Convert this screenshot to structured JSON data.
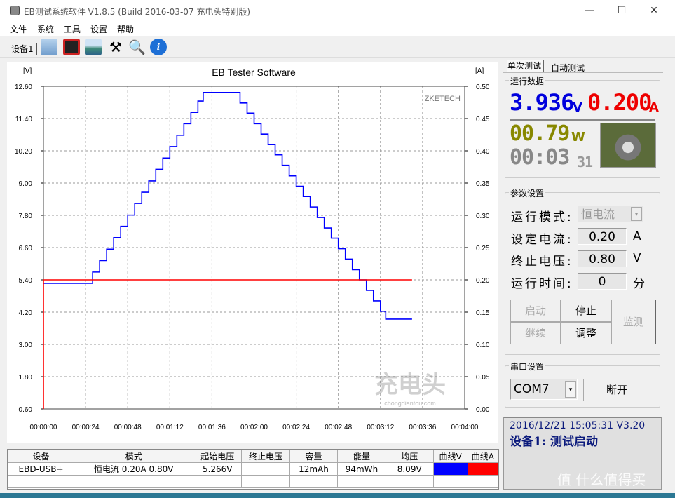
{
  "window": {
    "title": "EB测试系统软件 V1.8.5 (Build 2016-03-07 充电头特别版)",
    "minimize": "—",
    "maximize": "☐",
    "close": "✕"
  },
  "menu": [
    "文件",
    "系统",
    "工具",
    "设置",
    "帮助"
  ],
  "toolbar": {
    "device_tab": "设备1",
    "icons": [
      "folder-open-icon",
      "save-icon",
      "image-icon",
      "tools-icon",
      "search-icon",
      "info-icon"
    ]
  },
  "chart_data": {
    "type": "line",
    "title": "EB Tester Software",
    "ylabel": "[V]",
    "y2label": "[A]",
    "watermark": "ZKETECH",
    "logo_text": "充电头 chongdiantou.com",
    "xlim": [
      "00:00:00",
      "00:04:00"
    ],
    "ylim": [
      0.6,
      12.6
    ],
    "y2lim": [
      0,
      0.5
    ],
    "grid": true,
    "xticks": [
      "00:00:00",
      "00:00:24",
      "00:00:48",
      "00:01:12",
      "00:01:36",
      "00:02:00",
      "00:02:24",
      "00:02:48",
      "00:03:12",
      "00:03:36",
      "00:04:00"
    ],
    "yticks": [
      "0.60",
      "1.80",
      "3.00",
      "4.20",
      "5.40",
      "6.60",
      "7.80",
      "9.00",
      "10.20",
      "11.40",
      "12.60"
    ],
    "y2ticks": [
      "0.00",
      "0.05",
      "0.10",
      "0.15",
      "0.20",
      "0.25",
      "0.30",
      "0.35",
      "0.40",
      "0.45",
      "0.50"
    ],
    "series": [
      {
        "axis": "left",
        "color": "#0000ff",
        "points": [
          [
            0,
            5.27
          ],
          [
            24,
            5.27
          ],
          [
            28,
            5.69
          ],
          [
            32,
            6.12
          ],
          [
            36,
            6.54
          ],
          [
            40,
            6.97
          ],
          [
            44,
            7.39
          ],
          [
            48,
            7.81
          ],
          [
            52,
            8.24
          ],
          [
            56,
            8.66
          ],
          [
            60,
            9.08
          ],
          [
            64,
            9.51
          ],
          [
            68,
            9.93
          ],
          [
            72,
            10.36
          ],
          [
            76,
            10.78
          ],
          [
            80,
            11.21
          ],
          [
            84,
            11.63
          ],
          [
            88,
            12.05
          ],
          [
            91,
            12.37
          ],
          [
            108,
            12.37
          ],
          [
            112,
            11.98
          ],
          [
            116,
            11.6
          ],
          [
            120,
            11.21
          ],
          [
            124,
            10.82
          ],
          [
            128,
            10.43
          ],
          [
            132,
            10.05
          ],
          [
            136,
            9.66
          ],
          [
            140,
            9.27
          ],
          [
            144,
            8.88
          ],
          [
            148,
            8.5
          ],
          [
            152,
            8.11
          ],
          [
            156,
            7.72
          ],
          [
            160,
            7.33
          ],
          [
            164,
            6.95
          ],
          [
            168,
            6.56
          ],
          [
            172,
            6.17
          ],
          [
            176,
            5.78
          ],
          [
            180,
            5.4
          ],
          [
            184,
            5.01
          ],
          [
            188,
            4.62
          ],
          [
            192,
            4.23
          ],
          [
            195,
            3.94
          ],
          [
            210,
            3.94
          ]
        ]
      },
      {
        "axis": "right",
        "color": "#ff0000",
        "points": [
          [
            0,
            0
          ],
          [
            0,
            0.2
          ],
          [
            210,
            0.2
          ]
        ]
      }
    ]
  },
  "table": {
    "headers": [
      "设备",
      "模式",
      "起始电压",
      "终止电压",
      "容量",
      "能量",
      "均压",
      "曲线V",
      "曲线A"
    ],
    "rows": [
      [
        "EBD-USB+",
        "恒电流  0.20A  0.80V",
        "5.266V",
        "",
        "12mAh",
        "94mWh",
        "8.09V",
        "",
        ""
      ]
    ],
    "curve_colors": [
      "#0000ff",
      "#ff0000"
    ]
  },
  "right": {
    "tabs": [
      "单次测试",
      "自动测试"
    ],
    "run_data": {
      "label": "运行数据",
      "voltage": "3.936",
      "v_unit": "V",
      "current": "0.200",
      "a_unit": "A",
      "power": "00.79",
      "w_unit": "W",
      "time": "00:03",
      "time_sec": "31",
      "colors": {
        "voltage": "#0000dd",
        "current": "#ee0000",
        "power": "#888800",
        "time": "#888888"
      }
    },
    "params": {
      "label": "参数设置",
      "mode_label": "运行模式:",
      "mode": "恒电流",
      "current_label": "设定电流:",
      "current": "0.20",
      "current_unit": "A",
      "voltage_label": "终止电压:",
      "voltage": "0.80",
      "voltage_unit": "V",
      "time_label": "运行时间:",
      "time": "0",
      "time_unit": "分"
    },
    "buttons": {
      "start": "启动",
      "stop": "停止",
      "resume": "继续",
      "adjust": "调整",
      "monitor": "监测"
    },
    "serial": {
      "label": "串口设置",
      "port": "COM7",
      "disconnect": "断开"
    },
    "status": {
      "line1": "2016/12/21 15:05:31  V3.20",
      "line2": "设备1: 测试启动",
      "watermark": "值 什么值得买"
    }
  }
}
